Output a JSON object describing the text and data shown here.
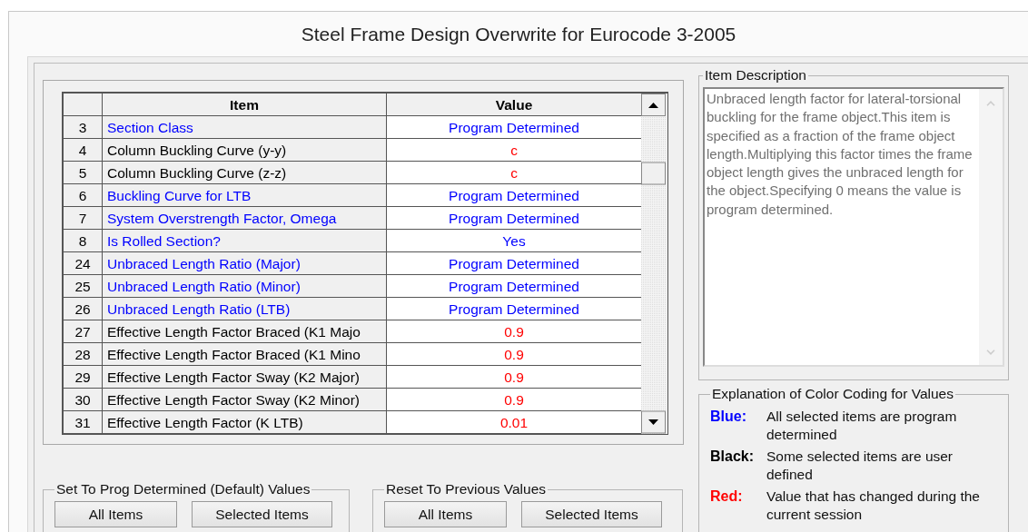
{
  "window": {
    "title": "Steel Frame Design Overwrite for Eurocode 3-2005"
  },
  "table": {
    "columns": [
      "Item",
      "Value"
    ],
    "rows": [
      {
        "number": "3",
        "item": {
          "text": "Section Class",
          "color": "#0000ff"
        },
        "value": {
          "text": "Program Determined",
          "color": "#0000ff"
        }
      },
      {
        "number": "4",
        "item": {
          "text": "Column Buckling Curve (y-y)",
          "color": "#000000"
        },
        "value": {
          "text": "c",
          "color": "#ff0000"
        }
      },
      {
        "number": "5",
        "item": {
          "text": "Column Buckling Curve (z-z)",
          "color": "#000000"
        },
        "value": {
          "text": "c",
          "color": "#ff0000"
        }
      },
      {
        "number": "6",
        "item": {
          "text": "Buckling Curve for LTB",
          "color": "#0000ff"
        },
        "value": {
          "text": "Program Determined",
          "color": "#0000ff"
        }
      },
      {
        "number": "7",
        "item": {
          "text": "System Overstrength Factor, Omega",
          "color": "#0000ff"
        },
        "value": {
          "text": "Program Determined",
          "color": "#0000ff"
        }
      },
      {
        "number": "8",
        "item": {
          "text": "Is Rolled Section?",
          "color": "#0000ff"
        },
        "value": {
          "text": "Yes",
          "color": "#0000ff"
        }
      },
      {
        "number": "24",
        "item": {
          "text": "Unbraced Length Ratio (Major)",
          "color": "#0000ff"
        },
        "value": {
          "text": "Program Determined",
          "color": "#0000ff"
        }
      },
      {
        "number": "25",
        "item": {
          "text": "Unbraced Length Ratio (Minor)",
          "color": "#0000ff"
        },
        "value": {
          "text": "Program Determined",
          "color": "#0000ff"
        }
      },
      {
        "number": "26",
        "item": {
          "text": "Unbraced Length Ratio (LTB)",
          "color": "#0000ff"
        },
        "value": {
          "text": "Program Determined",
          "color": "#0000ff"
        }
      },
      {
        "number": "27",
        "item": {
          "text": "Effective Length Factor Braced (K1 Majo",
          "color": "#000000"
        },
        "value": {
          "text": "0.9",
          "color": "#ff0000"
        }
      },
      {
        "number": "28",
        "item": {
          "text": "Effective Length Factor Braced (K1 Mino",
          "color": "#000000"
        },
        "value": {
          "text": "0.9",
          "color": "#ff0000"
        }
      },
      {
        "number": "29",
        "item": {
          "text": "Effective Length Factor Sway (K2 Major)",
          "color": "#000000"
        },
        "value": {
          "text": "0.9",
          "color": "#ff0000"
        }
      },
      {
        "number": "30",
        "item": {
          "text": "Effective Length Factor Sway (K2 Minor)",
          "color": "#000000"
        },
        "value": {
          "text": "0.9",
          "color": "#ff0000"
        }
      },
      {
        "number": "31",
        "item": {
          "text": "Effective Length Factor (K LTB)",
          "color": "#000000"
        },
        "value": {
          "text": "0.01",
          "color": "#ff0000"
        }
      }
    ]
  },
  "button_groups": [
    {
      "title": "Set To Prog Determined (Default) Values",
      "buttons": [
        "All Items",
        "Selected Items"
      ]
    },
    {
      "title": "Reset To Previous Values",
      "buttons": [
        "All Items",
        "Selected Items"
      ]
    }
  ],
  "item_description": {
    "title": "Item Description",
    "text": "Unbraced length factor for lateral-torsional buckling for the frame object.This item is specified as a fraction of the frame object length.Multiplying this factor times the frame object length gives the unbraced length for the object.Specifying 0 means the value is program determined."
  },
  "color_legend": {
    "title": "Explanation of Color Coding for Values",
    "entries": [
      {
        "label": "Blue:",
        "text": "All selected items are program determined",
        "color": "#0000ff"
      },
      {
        "label": "Black:",
        "text": "Some selected items are user defined",
        "color": "#000000"
      },
      {
        "label": "Red:",
        "text": "Value that has changed during the current session",
        "color": "#ff0000"
      }
    ]
  }
}
